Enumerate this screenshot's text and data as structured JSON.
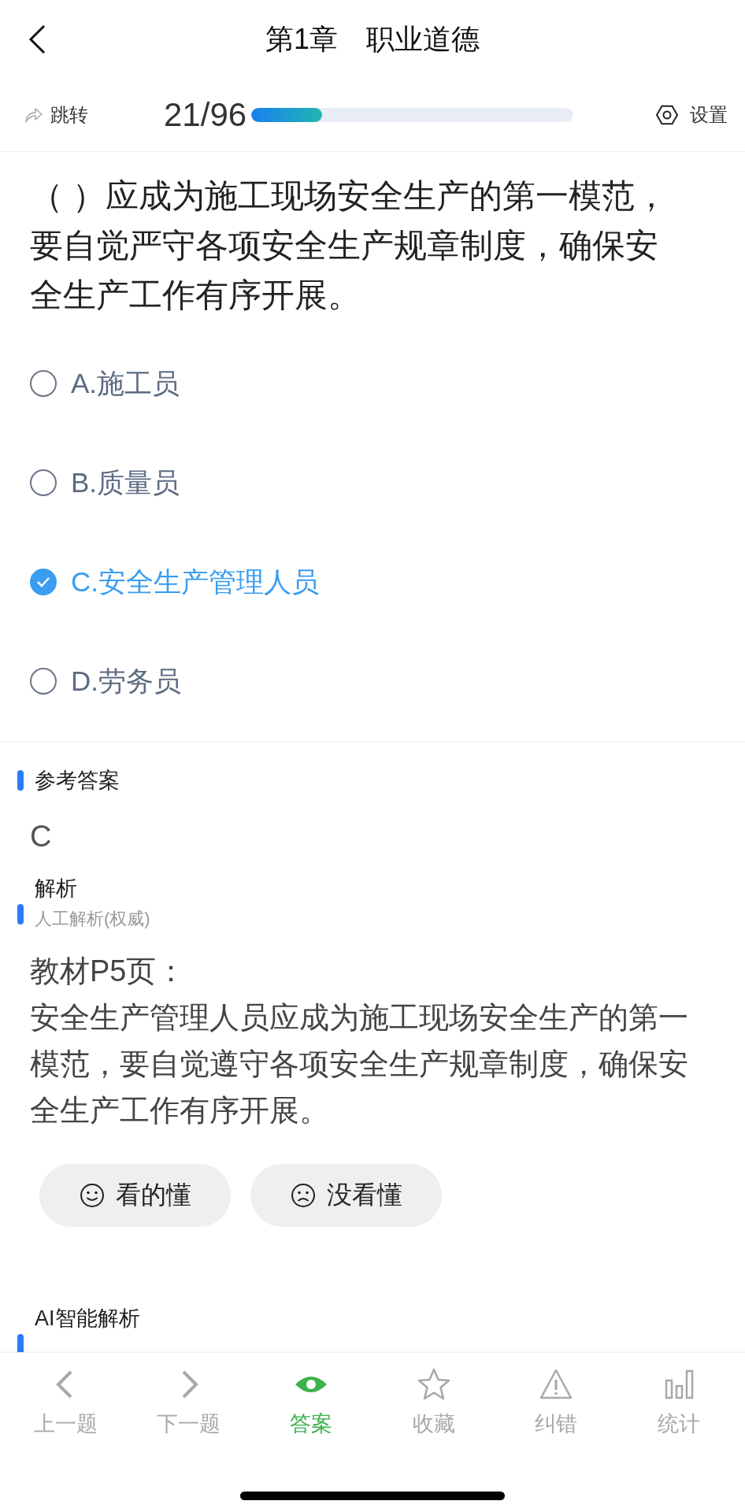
{
  "header": {
    "title": "第1章　职业道德"
  },
  "toolbar": {
    "jump": "跳转",
    "progress_text": "21/96",
    "progress": {
      "level": 0.22
    },
    "settings": "设置"
  },
  "question": {
    "text": "（ ）应成为施工现场安全生产的第一模范，要自觉严守各项安全生产规章制度，确保安全生产工作有序开展。",
    "options": [
      {
        "label": "A.施工员",
        "selected": false
      },
      {
        "label": "B.质量员",
        "selected": false
      },
      {
        "label": "C.安全生产管理人员",
        "selected": true
      },
      {
        "label": "D.劳务员",
        "selected": false
      }
    ]
  },
  "reference_answer": {
    "title": "参考答案",
    "answer": "C"
  },
  "analysis": {
    "title": "解析",
    "subtitle": "人工解析(权威)",
    "source": "教材P5页：",
    "body": "安全生产管理人员应成为施工现场安全生产的第一模范，要自觉遵守各项安全生产规章制度，确保安全生产工作有序开展。",
    "feedback": [
      {
        "kind": "smile",
        "label": "看的懂"
      },
      {
        "kind": "frown",
        "label": "没看懂"
      }
    ]
  },
  "ai_analysis": {
    "title": "AI智能解析"
  },
  "nav": [
    {
      "kind": "prev",
      "label": "上一题",
      "selected": false
    },
    {
      "kind": "next",
      "label": "下一题",
      "selected": false
    },
    {
      "kind": "answer",
      "label": "答案",
      "selected": true
    },
    {
      "kind": "favorite",
      "label": "收藏",
      "selected": false
    },
    {
      "kind": "report",
      "label": "纠错",
      "selected": false
    },
    {
      "kind": "stats",
      "label": "统计",
      "selected": false
    }
  ]
}
